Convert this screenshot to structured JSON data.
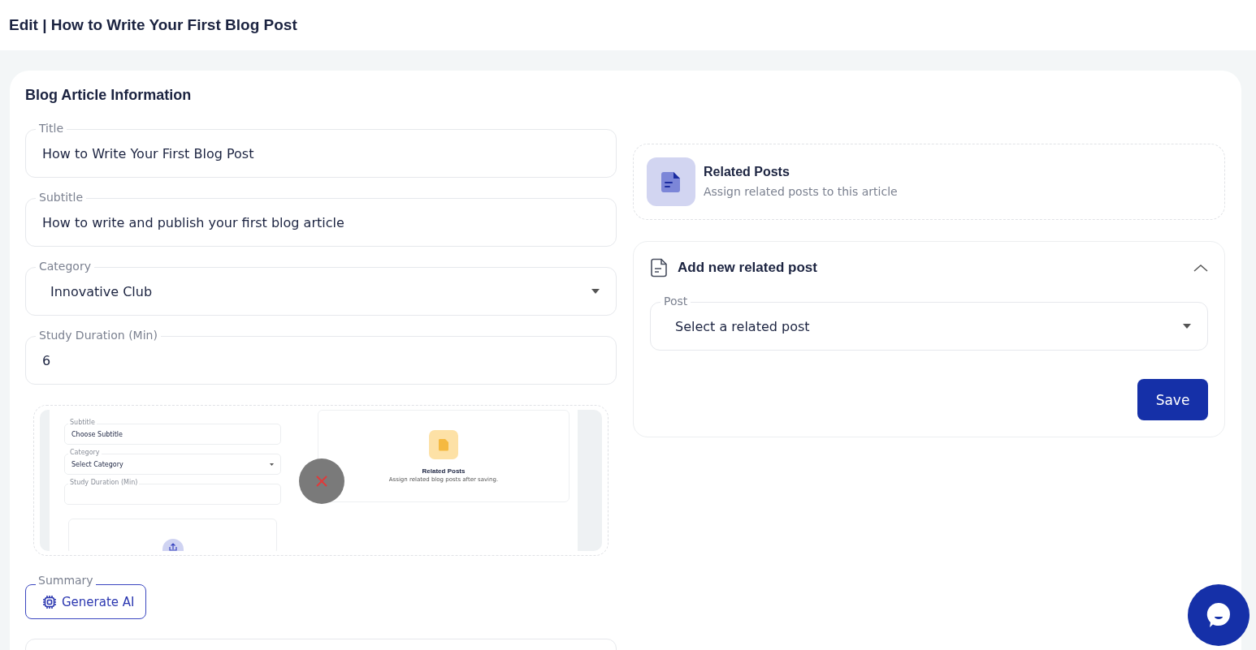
{
  "header": {
    "title": "Edit | How to Write Your First Blog Post"
  },
  "card": {
    "title": "Blog Article Information"
  },
  "fields": [
    {
      "kind": "text",
      "label": "Title",
      "value": "How to Write Your First Blog Post"
    },
    {
      "kind": "text",
      "label": "Subtitle",
      "value": "How to write and publish your first blog article"
    },
    {
      "kind": "select",
      "label": "Category",
      "value": "Innovative Club"
    },
    {
      "kind": "text",
      "label": "Study Duration (Min)",
      "value": "6"
    }
  ],
  "preview": {
    "fields": [
      {
        "kind": "text",
        "label": "Subtitle",
        "value": "Choose Subtitle"
      },
      {
        "kind": "select",
        "label": "Category",
        "value": "Select Category"
      },
      {
        "kind": "text",
        "label": "Study Duration (Min)"
      }
    ],
    "related": {
      "title": "Related Posts",
      "subtitle": "Assign related blog posts after saving."
    }
  },
  "summary": {
    "label": "Summary",
    "button": "Generate AI"
  },
  "related_posts": {
    "title": "Related Posts",
    "subtitle": "Assign related posts to this article"
  },
  "add_related": {
    "title": "Add new related post",
    "expanded": true,
    "field": {
      "label": "Post",
      "placeholder": "Select a related post"
    },
    "button": "Save"
  }
}
